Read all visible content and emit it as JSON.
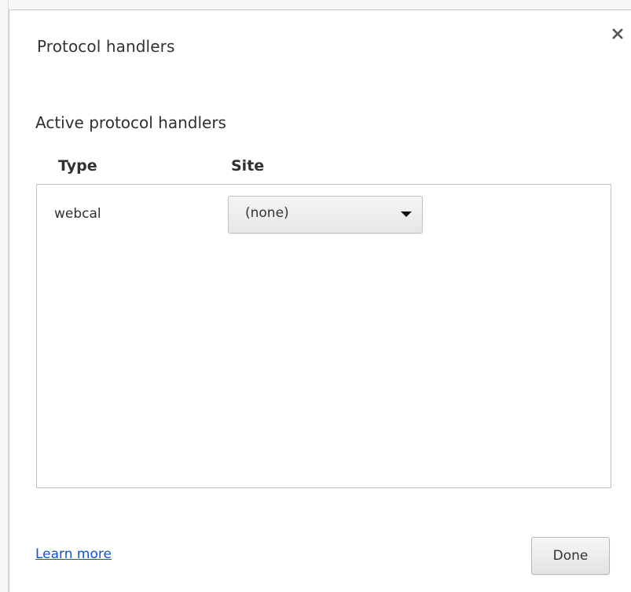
{
  "dialog": {
    "title": "Protocol handlers",
    "close_icon": "close-icon"
  },
  "section": {
    "heading": "Active protocol handlers",
    "columns": {
      "type": "Type",
      "site": "Site"
    },
    "rows": [
      {
        "type": "webcal",
        "site": "(none)"
      }
    ],
    "dropdown_icon": "dropdown-arrow-icon"
  },
  "footer": {
    "learn_more": "Learn more",
    "done": "Done"
  },
  "colors": {
    "link": "#1155cc",
    "border": "#bfbfbf",
    "text": "#333333"
  }
}
